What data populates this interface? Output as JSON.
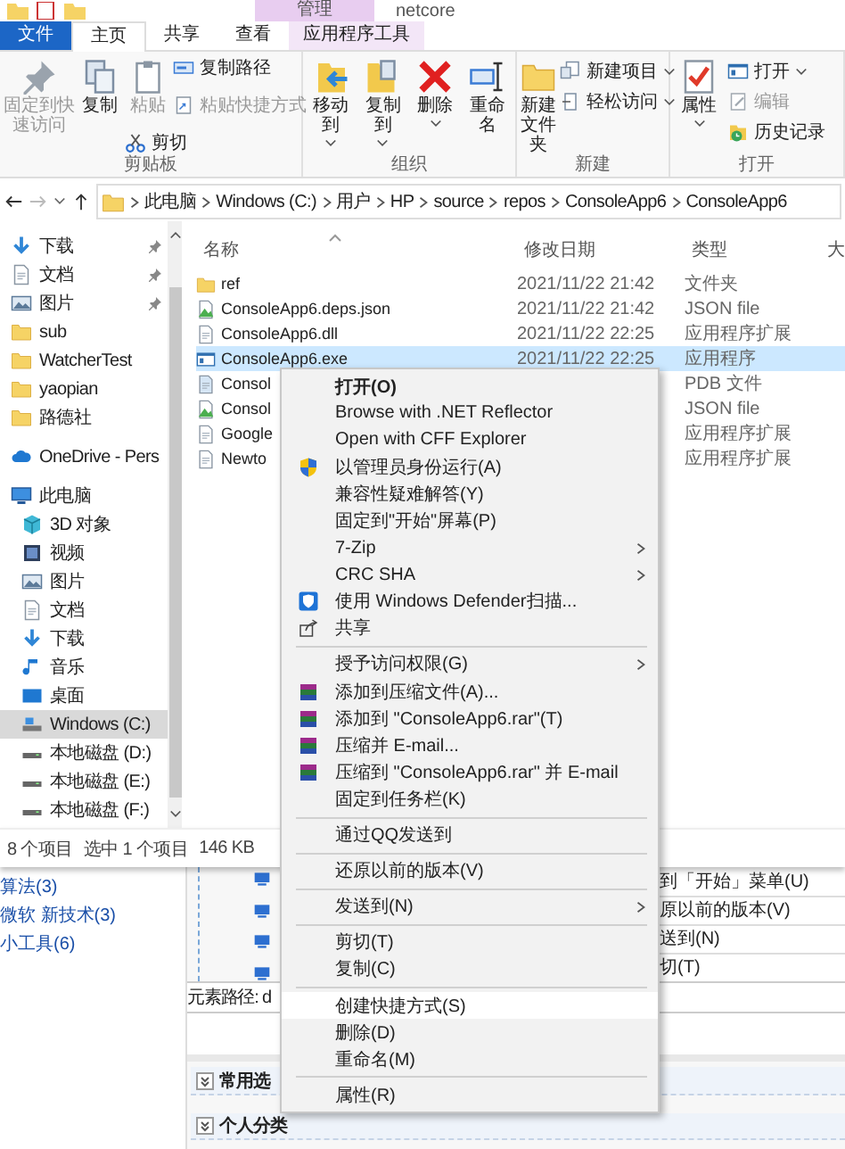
{
  "title_bar": {
    "context_tab": "管理",
    "title": "netcore"
  },
  "ribbon_tabs": [
    {
      "label": "文件",
      "kind": "file",
      "selected": false
    },
    {
      "label": "主页",
      "kind": "normal",
      "selected": true
    },
    {
      "label": "共享",
      "kind": "normal",
      "selected": false
    },
    {
      "label": "查看",
      "kind": "normal",
      "selected": false
    },
    {
      "label": "应用程序工具",
      "kind": "context",
      "selected": false
    }
  ],
  "ribbon_groups": [
    {
      "label": "剪贴板",
      "commands": [
        {
          "label": "固定到快速访问",
          "kind": "large",
          "disabled": true,
          "dropdown": false
        },
        {
          "label": "复制",
          "kind": "large",
          "disabled": false,
          "dropdown": false
        },
        {
          "label": "粘贴",
          "kind": "large",
          "disabled": true,
          "dropdown": false
        },
        {
          "label": "复制路径",
          "kind": "small",
          "disabled": false,
          "dropdown": false
        },
        {
          "label": "粘贴快捷方式",
          "kind": "small",
          "disabled": true,
          "dropdown": false
        },
        {
          "label": "剪切",
          "kind": "small",
          "disabled": false,
          "dropdown": false
        }
      ]
    },
    {
      "label": "组织",
      "commands": [
        {
          "label": "移动到",
          "kind": "large",
          "disabled": false,
          "dropdown": true
        },
        {
          "label": "复制到",
          "kind": "large",
          "disabled": false,
          "dropdown": true
        },
        {
          "label": "删除",
          "kind": "large",
          "disabled": false,
          "dropdown": true
        },
        {
          "label": "重命名",
          "kind": "large",
          "disabled": false,
          "dropdown": false
        }
      ]
    },
    {
      "label": "新建",
      "commands": [
        {
          "label": "新建文件夹",
          "kind": "large",
          "disabled": false,
          "dropdown": false
        },
        {
          "label": "新建项目",
          "kind": "small",
          "disabled": false,
          "dropdown": true
        },
        {
          "label": "轻松访问",
          "kind": "small",
          "disabled": false,
          "dropdown": true
        }
      ]
    },
    {
      "label": "打开",
      "commands": [
        {
          "label": "属性",
          "kind": "large",
          "disabled": false,
          "dropdown": true
        },
        {
          "label": "打开",
          "kind": "small",
          "disabled": false,
          "dropdown": true
        },
        {
          "label": "编辑",
          "kind": "small",
          "disabled": true,
          "dropdown": false
        },
        {
          "label": "历史记录",
          "kind": "small",
          "disabled": false,
          "dropdown": false
        }
      ]
    }
  ],
  "address_bar": {
    "path": [
      "此电脑",
      "Windows (C:)",
      "用户",
      "HP",
      "source",
      "repos",
      "ConsoleApp6",
      "ConsoleApp6"
    ]
  },
  "nav_pane": {
    "items": [
      {
        "label": "下载",
        "pinned": true,
        "selected": false
      },
      {
        "label": "文档",
        "pinned": true,
        "selected": false
      },
      {
        "label": "图片",
        "pinned": true,
        "selected": false
      },
      {
        "label": "sub",
        "pinned": false,
        "selected": false
      },
      {
        "label": "WatcherTest",
        "pinned": false,
        "selected": false
      },
      {
        "label": "yaopian",
        "pinned": false,
        "selected": false
      },
      {
        "label": "路德社",
        "pinned": false,
        "selected": false
      },
      {
        "label": "OneDrive - Pers",
        "pinned": false,
        "selected": false
      },
      {
        "label": "此电脑",
        "pinned": false,
        "selected": false,
        "children": [
          {
            "label": "3D 对象",
            "pinned": false,
            "selected": false
          },
          {
            "label": "视频",
            "pinned": false,
            "selected": false
          },
          {
            "label": "图片",
            "pinned": false,
            "selected": false
          },
          {
            "label": "文档",
            "pinned": false,
            "selected": false
          },
          {
            "label": "下载",
            "pinned": false,
            "selected": false
          },
          {
            "label": "音乐",
            "pinned": false,
            "selected": false
          },
          {
            "label": "桌面",
            "pinned": false,
            "selected": false
          },
          {
            "label": "Windows (C:)",
            "pinned": false,
            "selected": true
          },
          {
            "label": "本地磁盘 (D:)",
            "pinned": false,
            "selected": false
          },
          {
            "label": "本地磁盘 (E:)",
            "pinned": false,
            "selected": false
          },
          {
            "label": "本地磁盘 (F:)",
            "pinned": false,
            "selected": false
          }
        ]
      }
    ]
  },
  "file_list": {
    "columns": [
      "名称",
      "修改日期",
      "类型",
      "大"
    ],
    "rows": [
      {
        "name": "ref",
        "date": "2021/11/22 21:42",
        "type": "文件夹",
        "selected": false
      },
      {
        "name": "ConsoleApp6.deps.json",
        "date": "2021/11/22 21:42",
        "type": "JSON file",
        "selected": false
      },
      {
        "name": "ConsoleApp6.dll",
        "date": "2021/11/22 22:25",
        "type": "应用程序扩展",
        "selected": false
      },
      {
        "name": "ConsoleApp6.exe",
        "date": "2021/11/22 22:25",
        "type": "应用程序",
        "selected": true
      },
      {
        "name": "Consol",
        "type": "PDB 文件",
        "selected": false
      },
      {
        "name": "Consol",
        "type": "JSON file",
        "selected": false
      },
      {
        "name": "Google",
        "type": "应用程序扩展",
        "selected": false
      },
      {
        "name": "Newto",
        "type": "应用程序扩展",
        "selected": false
      }
    ]
  },
  "status_bar": {
    "count": "8 个项目",
    "selection": "选中 1 个项目",
    "size": "146 KB"
  },
  "context_menu": [
    {
      "kind": "item",
      "label": "打开(O)",
      "default": true,
      "submenu": false,
      "selected": false
    },
    {
      "kind": "item",
      "label": "Browse with .NET Reflector",
      "default": false,
      "submenu": false,
      "selected": false
    },
    {
      "kind": "item",
      "label": "Open with CFF Explorer",
      "default": false,
      "submenu": false,
      "selected": false
    },
    {
      "kind": "item",
      "label": "以管理员身份运行(A)",
      "default": false,
      "submenu": false,
      "selected": false
    },
    {
      "kind": "item",
      "label": "兼容性疑难解答(Y)",
      "default": false,
      "submenu": false,
      "selected": false
    },
    {
      "kind": "item",
      "label": "固定到\"开始\"屏幕(P)",
      "default": false,
      "submenu": false,
      "selected": false
    },
    {
      "kind": "item",
      "label": "7-Zip",
      "default": false,
      "submenu": true,
      "selected": false
    },
    {
      "kind": "item",
      "label": "CRC SHA",
      "default": false,
      "submenu": true,
      "selected": false
    },
    {
      "kind": "item",
      "label": "使用 Windows Defender扫描...",
      "default": false,
      "submenu": false,
      "selected": false
    },
    {
      "kind": "item",
      "label": "共享",
      "default": false,
      "submenu": false,
      "selected": false
    },
    {
      "kind": "separator"
    },
    {
      "kind": "item",
      "label": "授予访问权限(G)",
      "default": false,
      "submenu": true,
      "selected": false
    },
    {
      "kind": "item",
      "label": "添加到压缩文件(A)...",
      "default": false,
      "submenu": false,
      "selected": false
    },
    {
      "kind": "item",
      "label": "添加到 \"ConsoleApp6.rar\"(T)",
      "default": false,
      "submenu": false,
      "selected": false
    },
    {
      "kind": "item",
      "label": "压缩并 E-mail...",
      "default": false,
      "submenu": false,
      "selected": false
    },
    {
      "kind": "item",
      "label": "压缩到 \"ConsoleApp6.rar\" 并 E-mail",
      "default": false,
      "submenu": false,
      "selected": false
    },
    {
      "kind": "item",
      "label": "固定到任务栏(K)",
      "default": false,
      "submenu": false,
      "selected": false
    },
    {
      "kind": "separator"
    },
    {
      "kind": "item",
      "label": "通过QQ发送到",
      "default": false,
      "submenu": false,
      "selected": false
    },
    {
      "kind": "separator"
    },
    {
      "kind": "item",
      "label": "还原以前的版本(V)",
      "default": false,
      "submenu": false,
      "selected": false
    },
    {
      "kind": "separator"
    },
    {
      "kind": "item",
      "label": "发送到(N)",
      "default": false,
      "submenu": true,
      "selected": false
    },
    {
      "kind": "separator"
    },
    {
      "kind": "item",
      "label": "剪切(T)",
      "default": false,
      "submenu": false,
      "selected": false
    },
    {
      "kind": "item",
      "label": "复制(C)",
      "default": false,
      "submenu": false,
      "selected": false
    },
    {
      "kind": "separator"
    },
    {
      "kind": "item",
      "label": "创建快捷方式(S)",
      "default": false,
      "submenu": false,
      "selected": true
    },
    {
      "kind": "item",
      "label": "删除(D)",
      "default": false,
      "submenu": false,
      "selected": false
    },
    {
      "kind": "item",
      "label": "重命名(M)",
      "default": false,
      "submenu": false,
      "selected": false
    },
    {
      "kind": "separator"
    },
    {
      "kind": "item",
      "label": "属性(R)",
      "default": false,
      "submenu": false,
      "selected": false
    }
  ],
  "background_page": {
    "categories": [
      "算法(3)",
      "微软 新技术(3)",
      "小工具(6)"
    ],
    "menu_fragments": [
      "到「开始」菜单(U)",
      "原以前的版本(V)",
      "送到(N)",
      "切(T)"
    ],
    "element_path": "元素路径: d",
    "sections": [
      "常用选",
      "个人分类"
    ]
  }
}
